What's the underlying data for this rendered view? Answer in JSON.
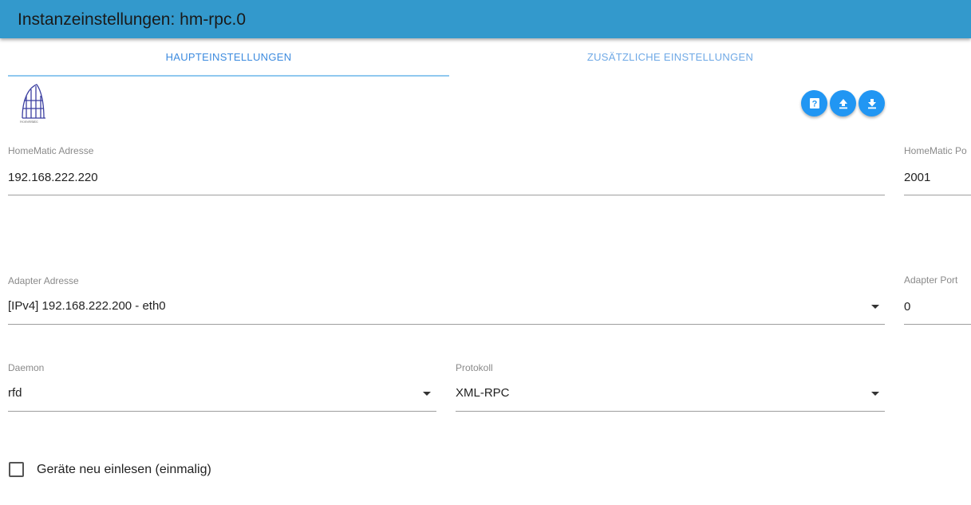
{
  "header": {
    "title": "Instanzeinstellungen: hm-rpc.0"
  },
  "tabs": [
    {
      "label": "HAUPTEINSTELLUNGEN",
      "active": true
    },
    {
      "label": "ZUSÄTZLICHE EINSTELLUNGEN",
      "active": false
    }
  ],
  "logo": {
    "text": "HomeMatic"
  },
  "toolbar": {
    "buttons": [
      {
        "icon": "help-icon"
      },
      {
        "icon": "upload-icon"
      },
      {
        "icon": "download-icon"
      }
    ]
  },
  "fields": {
    "homematic_address": {
      "label": "HomeMatic Adresse",
      "value": "192.168.222.220"
    },
    "homematic_port": {
      "label": "HomeMatic Po",
      "value": "2001"
    },
    "adapter_address": {
      "label": "Adapter Adresse",
      "value": "[IPv4] 192.168.222.200 - eth0"
    },
    "adapter_port": {
      "label": "Adapter Port",
      "value": "0"
    },
    "daemon": {
      "label": "Daemon",
      "value": "rfd"
    },
    "protocol": {
      "label": "Protokoll",
      "value": "XML-RPC"
    }
  },
  "options": {
    "reload_devices": {
      "label": "Geräte neu einlesen (einmalig)",
      "checked": false
    }
  },
  "colors": {
    "header": "#3399cc",
    "accent": "#2196f3",
    "tab_active": "#3d8bdf"
  }
}
